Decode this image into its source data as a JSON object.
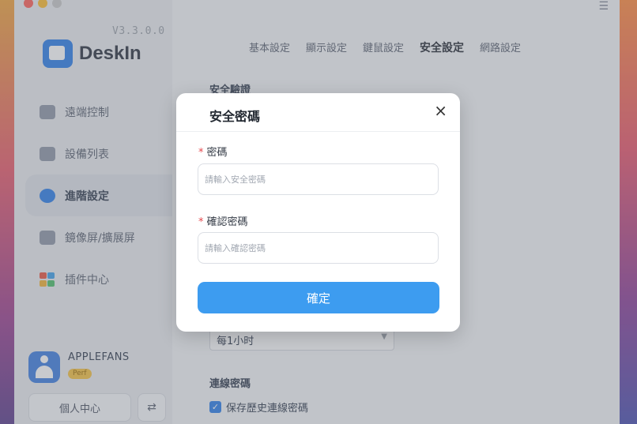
{
  "app": {
    "version": "V3.3.0.0",
    "logo_text": "DeskIn",
    "menu_icon": "☰"
  },
  "sidebar": {
    "items": [
      {
        "label": "遠端控制",
        "icon": "remote-icon"
      },
      {
        "label": "設備列表",
        "icon": "devices-icon"
      },
      {
        "label": "進階設定",
        "icon": "gear-icon",
        "active": true
      },
      {
        "label": "鏡像屏/擴展屏",
        "icon": "mirror-icon"
      },
      {
        "label": "插件中心",
        "icon": "plugin-icon"
      }
    ],
    "user": {
      "name": "APPLEFANS",
      "badge": "Perf"
    },
    "personal_center": "個人中心",
    "swap_icon": "⇄"
  },
  "main": {
    "tabs": [
      "基本設定",
      "顯示設定",
      "鍵鼠設定",
      "安全設定",
      "網路設定"
    ],
    "active_tab": "安全設定",
    "section_heading": "安全驗證",
    "interval_select": "每1小时",
    "password_heading": "連線密碼",
    "save_history_label": "保存歷史連線密碼"
  },
  "modal": {
    "title": "安全密碼",
    "close": "×",
    "password_label": "密碼",
    "password_placeholder": "請輸入安全密碼",
    "confirm_label": "確認密碼",
    "confirm_placeholder": "請輸入確認密碼",
    "required_mark": "*",
    "submit": "確定"
  },
  "colors": {
    "accent": "#3d9cf0",
    "brand": "#2d7ee8",
    "required": "#e5484d"
  }
}
